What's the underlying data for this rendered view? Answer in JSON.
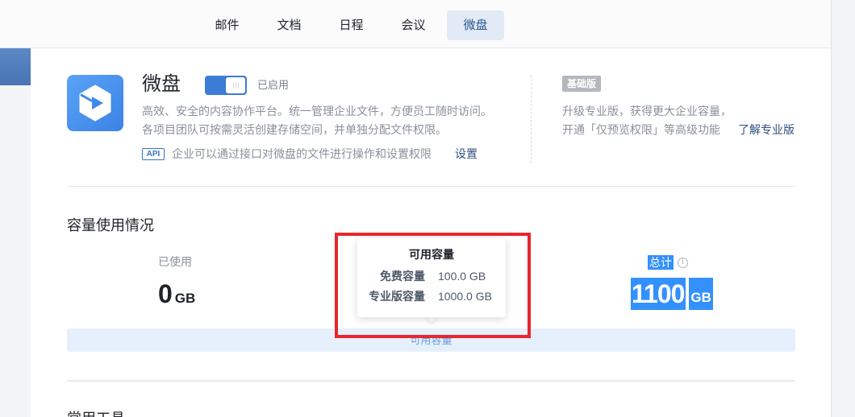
{
  "tabs": [
    {
      "label": "邮件",
      "active": false
    },
    {
      "label": "文档",
      "active": false
    },
    {
      "label": "日程",
      "active": false
    },
    {
      "label": "会议",
      "active": false
    },
    {
      "label": "微盘",
      "active": true
    }
  ],
  "app": {
    "name": "微盘",
    "enabled": true,
    "status": "已启用",
    "description": [
      "高效、安全的内容协作平台。统一管理企业文件，方便员工随时访问。",
      "各项目团队可按需灵活创建存储空间，并单独分配文件权限。"
    ],
    "api_badge": "API",
    "api_text": "企业可以通过接口对微盘的文件进行操作和设置权限",
    "api_settings_link": "设置"
  },
  "plan": {
    "badge": "基础版",
    "lines": [
      "升级专业版，获得更大企业容量，",
      "开通「仅预览权限」等高级功能"
    ],
    "learn_more": "了解专业版"
  },
  "capacity": {
    "title": "容量使用情况",
    "used": {
      "label": "已使用",
      "value": "0",
      "unit": "GB"
    },
    "total": {
      "label": "总计",
      "value": "1100",
      "unit": "GB"
    },
    "bar_label": "可用容量",
    "available_fraction": 1.0,
    "tooltip": {
      "title": "可用容量",
      "rows": [
        {
          "label": "免费容量",
          "value": "100.0 GB"
        },
        {
          "label": "专业版容量",
          "value": "1000.0 GB"
        }
      ]
    }
  },
  "tools": {
    "title": "常用工具"
  },
  "icons": {
    "app_logo": "weipan-logo-icon",
    "total_info": "info-icon",
    "toggle": "toggle-switch"
  },
  "colors": {
    "accent": "#3b7dd6",
    "selection": "#3390ff",
    "annotation": "#e8262b",
    "badge": "#b3b7be"
  }
}
